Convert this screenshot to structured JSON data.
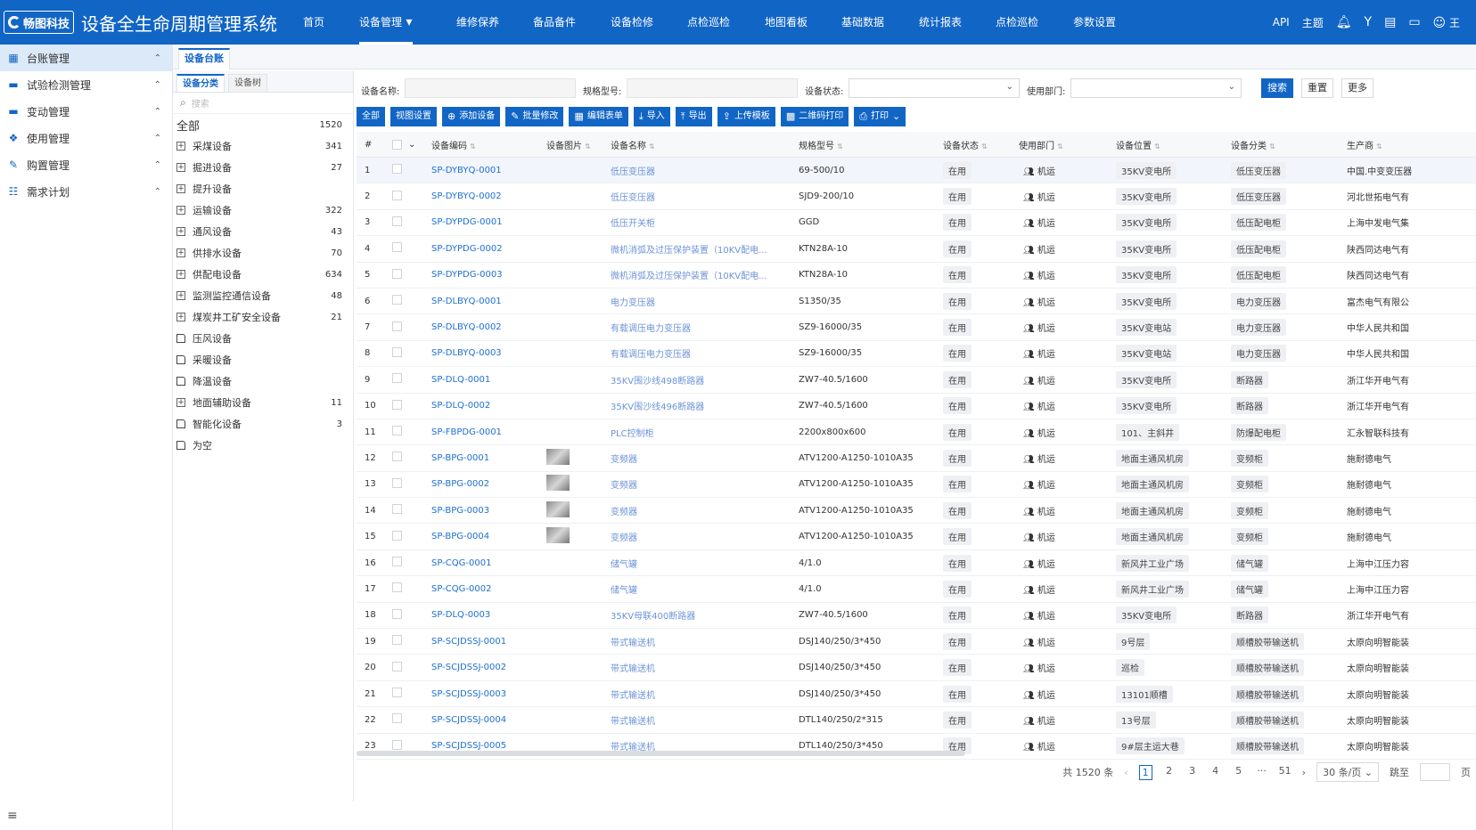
{
  "app": {
    "logo_text": "畅图科技",
    "title": "设备全生命周期管理系统"
  },
  "nav": [
    {
      "label": "首页"
    },
    {
      "label": "设备管理"
    },
    {
      "label": "维修保养"
    },
    {
      "label": "备品备件"
    },
    {
      "label": "设备检修"
    },
    {
      "label": "点检巡检"
    },
    {
      "label": "地图看板"
    },
    {
      "label": "基础数据"
    },
    {
      "label": "统计报表"
    },
    {
      "label": "点检巡检"
    },
    {
      "label": "参数设置"
    }
  ],
  "topright": {
    "api": "API",
    "theme": "主题",
    "user": "王"
  },
  "sidebar": [
    {
      "label": "台账管理"
    },
    {
      "label": "试验检测管理"
    },
    {
      "label": "变动管理"
    },
    {
      "label": "使用管理"
    },
    {
      "label": "购置管理"
    },
    {
      "label": "需求计划"
    }
  ],
  "page_tab": "设备台账",
  "tree": {
    "tabs": [
      "设备分类",
      "设备树"
    ],
    "search_placeholder": "搜索",
    "all_label": "全部",
    "all_count": "1520",
    "nodes": [
      {
        "label": "采煤设备",
        "count": "341",
        "type": "plus"
      },
      {
        "label": "掘进设备",
        "count": "27",
        "type": "plus"
      },
      {
        "label": "提升设备",
        "count": "",
        "type": "plus"
      },
      {
        "label": "运输设备",
        "count": "322",
        "type": "plus"
      },
      {
        "label": "通风设备",
        "count": "43",
        "type": "plus"
      },
      {
        "label": "供排水设备",
        "count": "70",
        "type": "plus"
      },
      {
        "label": "供配电设备",
        "count": "634",
        "type": "plus"
      },
      {
        "label": "监测监控通信设备",
        "count": "48",
        "type": "plus"
      },
      {
        "label": "煤炭井工矿安全设备",
        "count": "21",
        "type": "plus"
      },
      {
        "label": "压风设备",
        "count": "",
        "type": "doc"
      },
      {
        "label": "采暖设备",
        "count": "",
        "type": "doc"
      },
      {
        "label": "降温设备",
        "count": "",
        "type": "doc"
      },
      {
        "label": "地面辅助设备",
        "count": "11",
        "type": "plus"
      },
      {
        "label": "智能化设备",
        "count": "3",
        "type": "doc"
      },
      {
        "label": "为空",
        "count": "",
        "type": "doc"
      }
    ]
  },
  "filters": {
    "name_label": "设备名称:",
    "model_label": "规格型号:",
    "status_label": "设备状态:",
    "dept_label": "使用部门:",
    "search": "搜索",
    "reset": "重置",
    "more": "更多"
  },
  "toolbar": [
    "全部",
    "视图设置",
    "添加设备",
    "批量修改",
    "编辑表单",
    "导入",
    "导出",
    "上传模板",
    "二维码打印",
    "打印"
  ],
  "columns": [
    "#",
    "设备编码",
    "设备图片",
    "设备名称",
    "规格型号",
    "设备状态",
    "使用部门",
    "设备位置",
    "设备分类",
    "生产商"
  ],
  "rows": [
    {
      "n": "1",
      "code": "SP-DYBYQ-0001",
      "img": false,
      "name": "低压变压器",
      "model": "69-500/10",
      "status": "在用",
      "dept": "机运",
      "loc": "35KV变电所",
      "cat": "低压变压器",
      "mfr": "中国.中变变压器"
    },
    {
      "n": "2",
      "code": "SP-DYBYQ-0002",
      "img": false,
      "name": "低压变压器",
      "model": "SJD9-200/10",
      "status": "在用",
      "dept": "机运",
      "loc": "35KV变电所",
      "cat": "低压变压器",
      "mfr": "河北世拓电气有"
    },
    {
      "n": "3",
      "code": "SP-DYPDG-0001",
      "img": false,
      "name": "低压开关柜",
      "model": "GGD",
      "status": "在用",
      "dept": "机运",
      "loc": "35KV变电所",
      "cat": "低压配电柜",
      "mfr": "上海中发电气集"
    },
    {
      "n": "4",
      "code": "SP-DYPDG-0002",
      "img": false,
      "name": "微机消弧及过压保护装置（10KV配电...",
      "model": "KTN28A-10",
      "status": "在用",
      "dept": "机运",
      "loc": "35KV变电所",
      "cat": "低压配电柜",
      "mfr": "陕西同达电气有"
    },
    {
      "n": "5",
      "code": "SP-DYPDG-0003",
      "img": false,
      "name": "微机消弧及过压保护装置（10KV配电...",
      "model": "KTN28A-10",
      "status": "在用",
      "dept": "机运",
      "loc": "35KV变电所",
      "cat": "低压配电柜",
      "mfr": "陕西同达电气有"
    },
    {
      "n": "6",
      "code": "SP-DLBYQ-0001",
      "img": false,
      "name": "电力变压器",
      "model": "S1350/35",
      "status": "在用",
      "dept": "机运",
      "loc": "35KV变电所",
      "cat": "电力变压器",
      "mfr": "富杰电气有限公"
    },
    {
      "n": "7",
      "code": "SP-DLBYQ-0002",
      "img": false,
      "name": "有载调压电力变压器",
      "model": "SZ9-16000/35",
      "status": "在用",
      "dept": "机运",
      "loc": "35KV变电站",
      "cat": "电力变压器",
      "mfr": "中华人民共和国"
    },
    {
      "n": "8",
      "code": "SP-DLBYQ-0003",
      "img": false,
      "name": "有载调压电力变压器",
      "model": "SZ9-16000/35",
      "status": "在用",
      "dept": "机运",
      "loc": "35KV变电站",
      "cat": "电力变压器",
      "mfr": "中华人民共和国"
    },
    {
      "n": "9",
      "code": "SP-DLQ-0001",
      "img": false,
      "name": "35KV围沙线498断路器",
      "model": "ZW7-40.5/1600",
      "status": "在用",
      "dept": "机运",
      "loc": "35KV变电所",
      "cat": "断路器",
      "mfr": "浙江华开电气有"
    },
    {
      "n": "10",
      "code": "SP-DLQ-0002",
      "img": false,
      "name": "35KV围沙线496断路器",
      "model": "ZW7-40.5/1600",
      "status": "在用",
      "dept": "机运",
      "loc": "35KV变电所",
      "cat": "断路器",
      "mfr": "浙江华开电气有"
    },
    {
      "n": "11",
      "code": "SP-FBPDG-0001",
      "img": false,
      "name": "PLC控制柜",
      "model": "2200x800x600",
      "status": "在用",
      "dept": "机运",
      "loc": "101、主斜井",
      "cat": "防爆配电柜",
      "mfr": "汇永智联科技有"
    },
    {
      "n": "12",
      "code": "SP-BPG-0001",
      "img": true,
      "name": "变频器",
      "model": "ATV1200-A1250-1010A35",
      "status": "在用",
      "dept": "机运",
      "loc": "地面主通风机房",
      "cat": "变频柜",
      "mfr": "施耐德电气"
    },
    {
      "n": "13",
      "code": "SP-BPG-0002",
      "img": true,
      "name": "变频器",
      "model": "ATV1200-A1250-1010A35",
      "status": "在用",
      "dept": "机运",
      "loc": "地面主通风机房",
      "cat": "变频柜",
      "mfr": "施耐德电气"
    },
    {
      "n": "14",
      "code": "SP-BPG-0003",
      "img": true,
      "name": "变频器",
      "model": "ATV1200-A1250-1010A35",
      "status": "在用",
      "dept": "机运",
      "loc": "地面主通风机房",
      "cat": "变频柜",
      "mfr": "施耐德电气"
    },
    {
      "n": "15",
      "code": "SP-BPG-0004",
      "img": true,
      "name": "变频器",
      "model": "ATV1200-A1250-1010A35",
      "status": "在用",
      "dept": "机运",
      "loc": "地面主通风机房",
      "cat": "变频柜",
      "mfr": "施耐德电气"
    },
    {
      "n": "16",
      "code": "SP-CQG-0001",
      "img": false,
      "name": "储气罐",
      "model": "4/1.0",
      "status": "在用",
      "dept": "机运",
      "loc": "新风井工业广场",
      "cat": "储气罐",
      "mfr": "上海中江压力容"
    },
    {
      "n": "17",
      "code": "SP-CQG-0002",
      "img": false,
      "name": "储气罐",
      "model": "4/1.0",
      "status": "在用",
      "dept": "机运",
      "loc": "新风井工业广场",
      "cat": "储气罐",
      "mfr": "上海中江压力容"
    },
    {
      "n": "18",
      "code": "SP-DLQ-0003",
      "img": false,
      "name": "35KV母联400断路器",
      "model": "ZW7-40.5/1600",
      "status": "在用",
      "dept": "机运",
      "loc": "35KV变电所",
      "cat": "断路器",
      "mfr": "浙江华开电气有"
    },
    {
      "n": "19",
      "code": "SP-SCJDSSJ-0001",
      "img": false,
      "name": "带式输送机",
      "model": "DSJ140/250/3*450",
      "status": "在用",
      "dept": "机运",
      "loc": "9号层",
      "cat": "顺槽胶带输送机",
      "mfr": "太原向明智能装"
    },
    {
      "n": "20",
      "code": "SP-SCJDSSJ-0002",
      "img": false,
      "name": "带式输送机",
      "model": "DSJ140/250/3*450",
      "status": "在用",
      "dept": "机运",
      "loc": "巡检",
      "cat": "顺槽胶带输送机",
      "mfr": "太原向明智能装"
    },
    {
      "n": "21",
      "code": "SP-SCJDSSJ-0003",
      "img": false,
      "name": "带式输送机",
      "model": "DSJ140/250/3*450",
      "status": "在用",
      "dept": "机运",
      "loc": "13101顺槽",
      "cat": "顺槽胶带输送机",
      "mfr": "太原向明智能装"
    },
    {
      "n": "22",
      "code": "SP-SCJDSSJ-0004",
      "img": false,
      "name": "带式输送机",
      "model": "DTL140/250/2*315",
      "status": "在用",
      "dept": "机运",
      "loc": "13号层",
      "cat": "顺槽胶带输送机",
      "mfr": "太原向明智能装"
    },
    {
      "n": "23",
      "code": "SP-SCJDSSJ-0005",
      "img": false,
      "name": "带式输送机",
      "model": "DTL140/250/3*450",
      "status": "在用",
      "dept": "机运",
      "loc": "9#层主运大巷",
      "cat": "顺槽胶带输送机",
      "mfr": "太原向明智能装"
    }
  ],
  "pager": {
    "total": "共 1520 条",
    "pages": [
      "1",
      "2",
      "3",
      "4",
      "5",
      "···",
      "51"
    ],
    "size": "30 条/页",
    "goto": "跳至",
    "page_unit": "页"
  },
  "colors": {
    "primary": "#1165c5",
    "link": "#1e6fd0"
  }
}
